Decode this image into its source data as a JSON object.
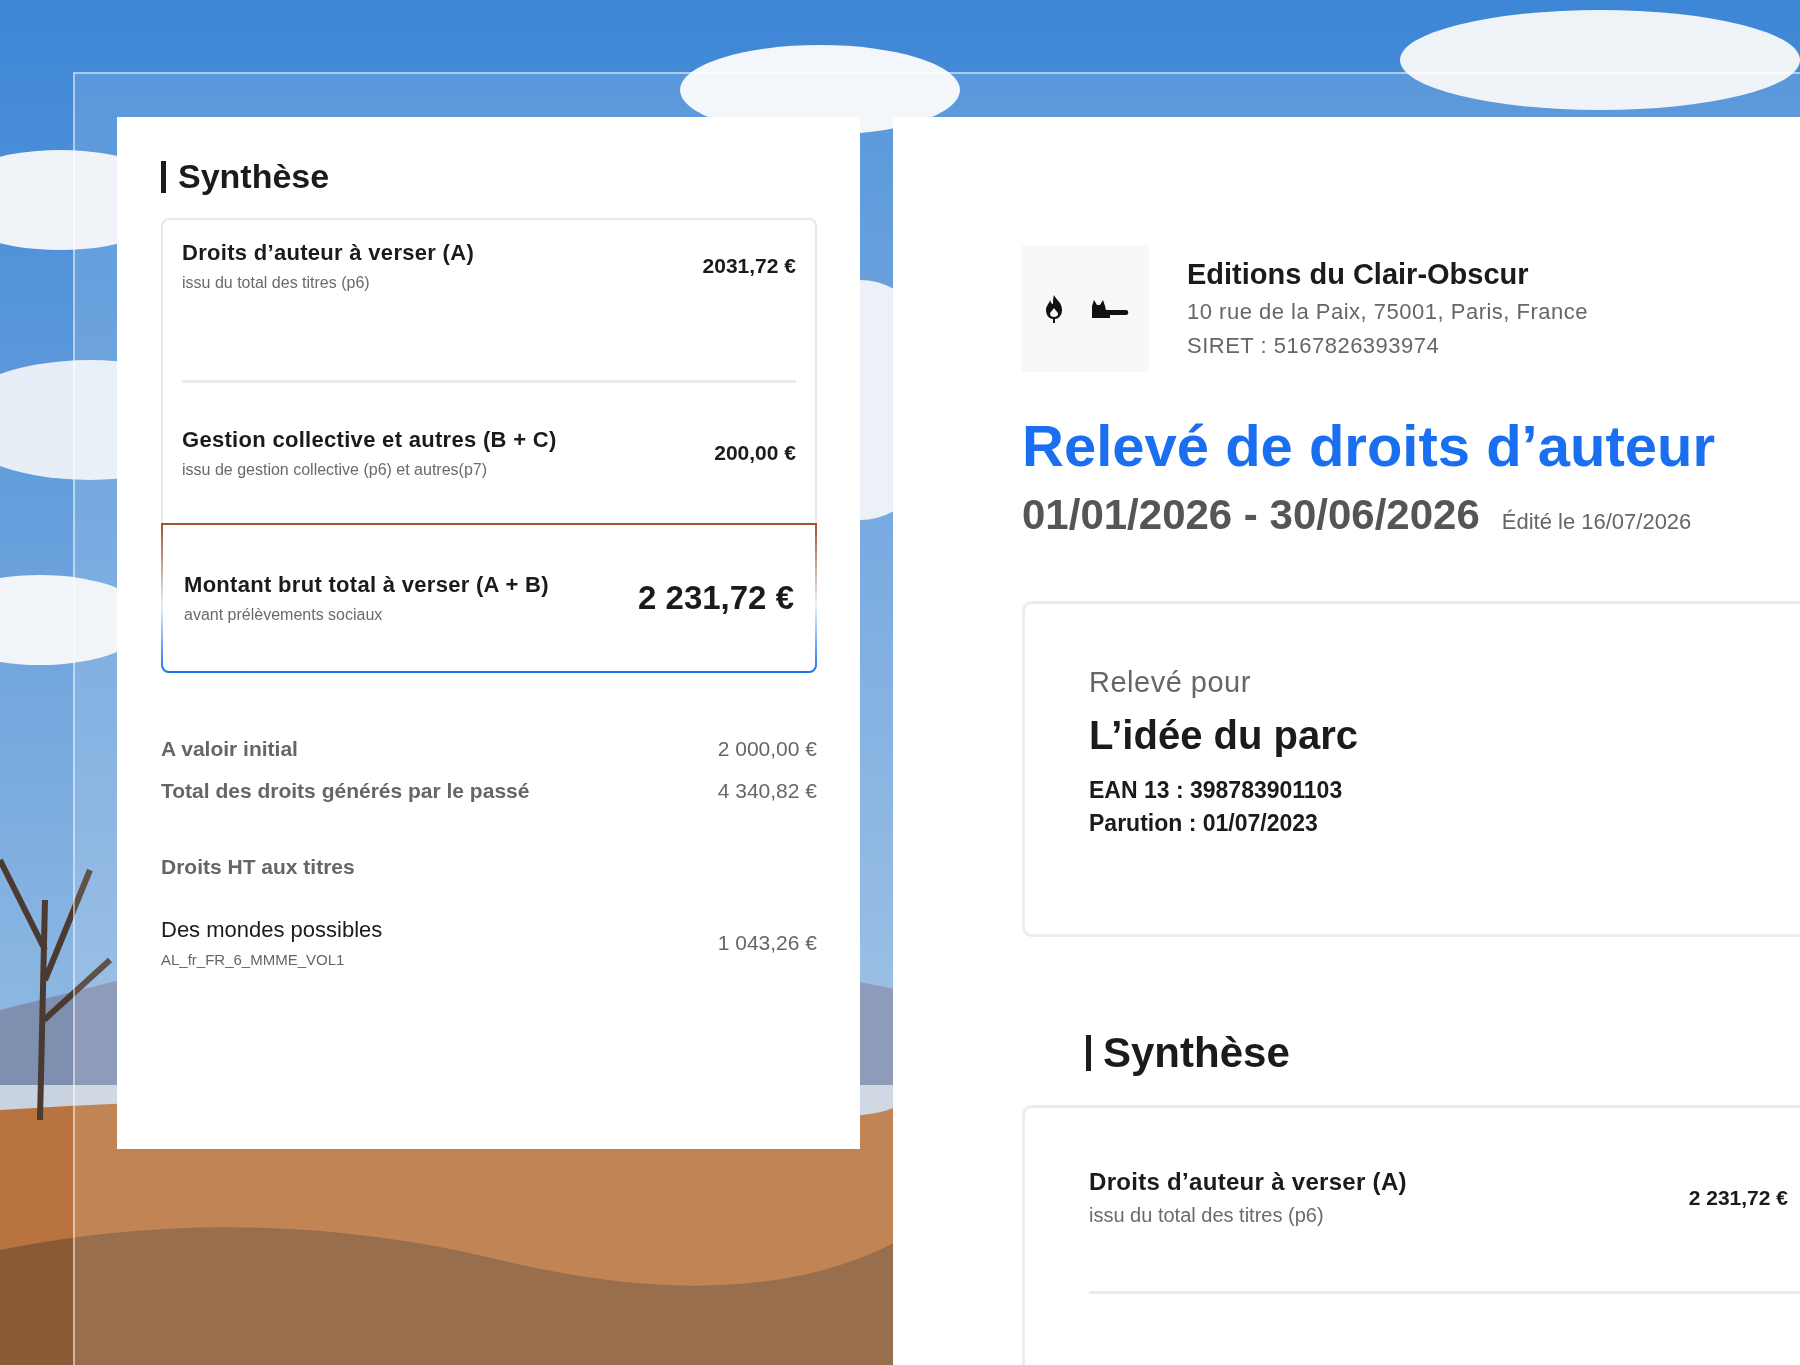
{
  "left_panel": {
    "heading": "Synthèse",
    "summary": [
      {
        "kind": "row",
        "label": "Droits d’auteur à verser (A)",
        "note": "issu du total des titres (p6)",
        "amount": "2031,72 €"
      },
      {
        "kind": "row",
        "label": "Gestion collective et autres (B + C)",
        "note": "issu de gestion collective (p6) et autres(p7)",
        "amount": "200,00 €"
      },
      {
        "kind": "total",
        "label": "Montant brut total à verser (A + B)",
        "note": "avant prélèvements sociaux",
        "amount": "2 231,72 €"
      }
    ],
    "details": [
      {
        "label": "A valoir initial",
        "amount": "2 000,00 €"
      },
      {
        "label": "Total des droits générés par le passé",
        "amount": "4 340,82 €"
      }
    ],
    "section_title": "Droits HT aux titres",
    "titles": [
      {
        "name": "Des mondes possibles",
        "code": "AL_fr_FR_6_MMME_VOL1",
        "amount": "1 043,26 €"
      }
    ]
  },
  "publisher": {
    "name": "Editions du Clair-Obscur",
    "address": "10 rue de la Paix, 75001, Paris, France",
    "siret": "SIRET : 5167826393974"
  },
  "statement": {
    "title": "Relevé de droits d’auteur",
    "period": "01/01/2026 - 30/06/2026",
    "edited": "Édité le 16/07/2026"
  },
  "recipient": {
    "caption": "Relevé pour",
    "title": "L’idée du parc",
    "ean": "EAN 13 : 398783901103",
    "release": "Parution : 01/07/2023"
  },
  "right_synthesis": {
    "heading": "Synthèse",
    "rows": [
      {
        "label": "Droits d’auteur à verser (A)",
        "note": "issu du total des titres (p6)",
        "amount": "2 231,72 €"
      }
    ]
  }
}
